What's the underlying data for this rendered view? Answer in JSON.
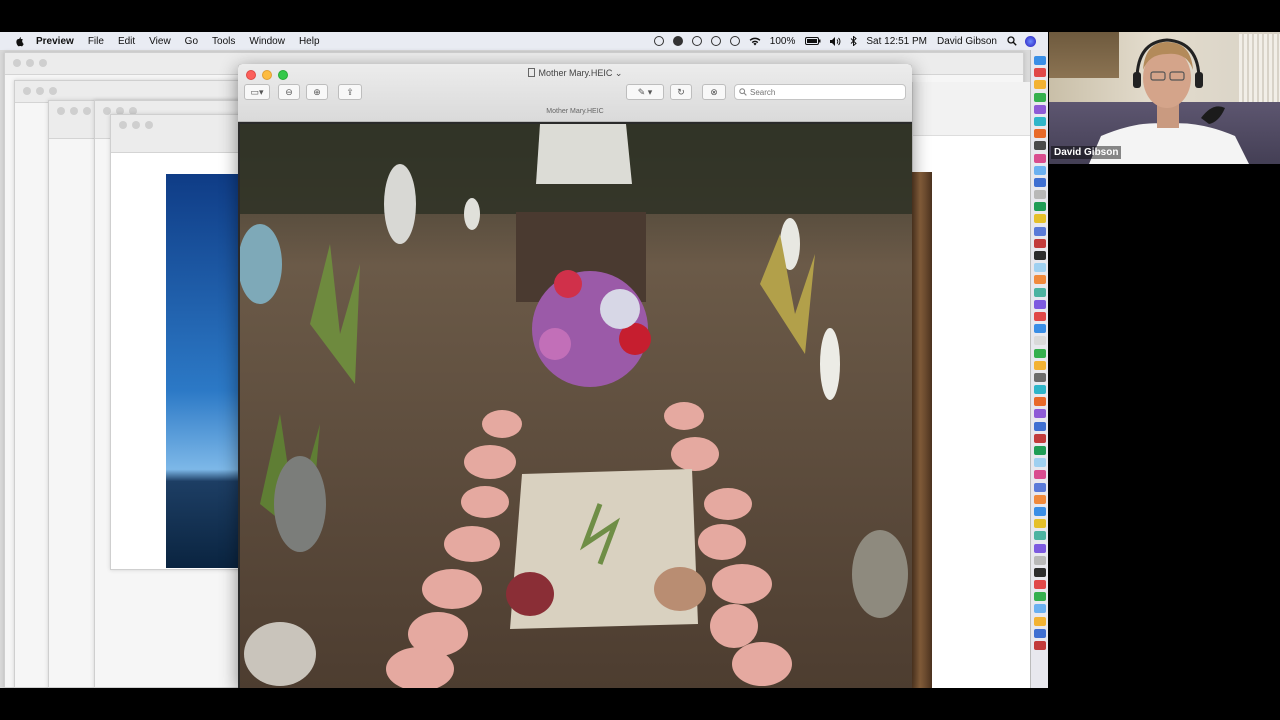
{
  "menubar": {
    "app_name": "Preview",
    "menus": [
      "File",
      "Edit",
      "View",
      "Go",
      "Tools",
      "Window",
      "Help"
    ],
    "battery": "100%",
    "clock": "Sat 12:51 PM",
    "user": "David Gibson"
  },
  "preview": {
    "window_title": "Mother Mary.HEIC",
    "subtitle": "Mother Mary.HEIC",
    "search_placeholder": "Search"
  },
  "webcam": {
    "participant_name": "David Gibson"
  },
  "colors": {
    "menubar_bg": "#e9ecf3",
    "traffic_red": "#fc605b",
    "traffic_yellow": "#fdbc40",
    "traffic_green": "#34c84a"
  }
}
